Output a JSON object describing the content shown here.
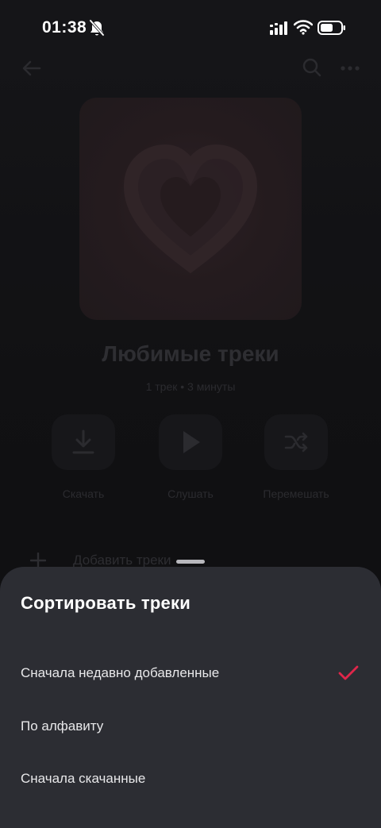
{
  "status_bar": {
    "time": "01:38"
  },
  "playlist": {
    "title": "Любимые треки",
    "meta": "1 трек • 3 минуты"
  },
  "actions": [
    {
      "label": "Скачать",
      "icon": "download-icon"
    },
    {
      "label": "Слушать",
      "icon": "play-icon"
    },
    {
      "label": "Перемешать",
      "icon": "shuffle-icon"
    }
  ],
  "add_tracks": {
    "label": "Добавить треки"
  },
  "sort_sheet": {
    "title": "Сортировать треки",
    "options": [
      {
        "label": "Сначала недавно добавленные",
        "selected": true
      },
      {
        "label": "По алфавиту",
        "selected": false
      },
      {
        "label": "Сначала скачанные",
        "selected": false
      }
    ]
  },
  "colors": {
    "accent": "#e0264a",
    "sheet_bg": "#2c2d33"
  }
}
